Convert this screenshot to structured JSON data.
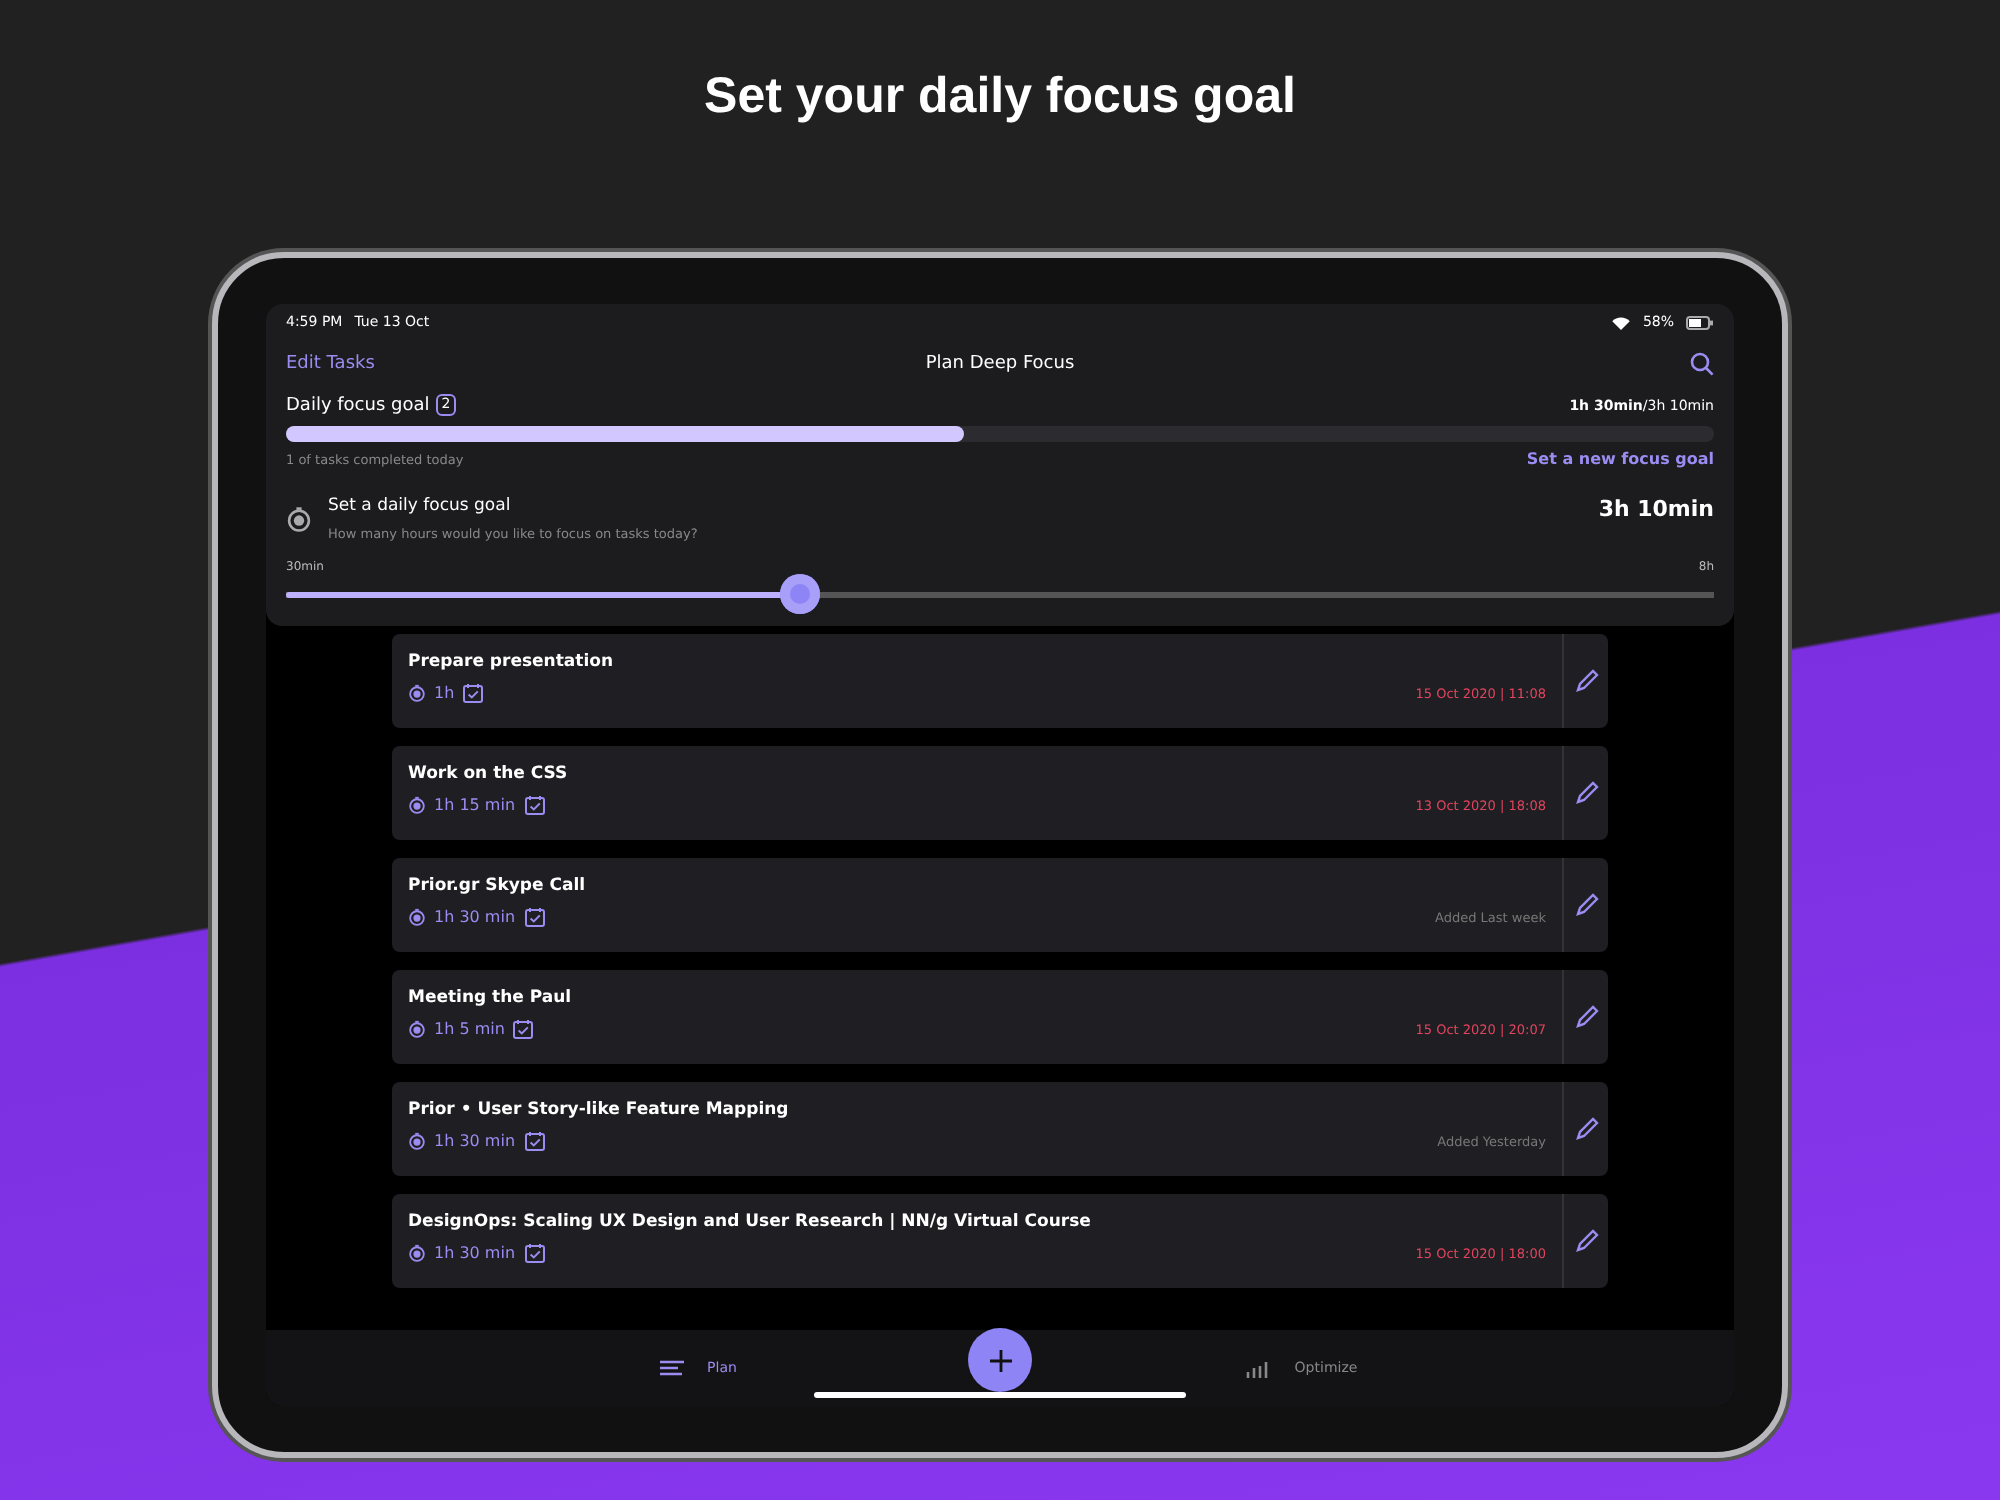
{
  "headline": "Set your daily focus goal",
  "status_bar": {
    "time": "4:59 PM",
    "date": "Tue 13 Oct",
    "battery": "58%"
  },
  "nav": {
    "left": "Edit Tasks",
    "title": "Plan Deep Focus"
  },
  "goal": {
    "label": "Daily focus goal",
    "count": "2",
    "done": "1h 30min",
    "total": "/3h 10min",
    "level": 0.475,
    "completed": "1 of tasks completed today",
    "link": "Set a new focus goal"
  },
  "setter": {
    "title": "Set a daily focus goal",
    "subtitle": "How many hours would you like to focus on tasks today?",
    "value": "3h 10min",
    "min": "30min",
    "max": "8h",
    "level": 0.36
  },
  "tasks": [
    {
      "title": "Prepare presentation",
      "duration": "1h",
      "note": "15 Oct 2020 | 11:08",
      "kind": "due"
    },
    {
      "title": "Work on the CSS",
      "duration": "1h 15 min",
      "note": "13 Oct 2020 | 18:08",
      "kind": "due"
    },
    {
      "title": "Prior.gr Skype Call",
      "duration": "1h 30 min",
      "note": "Added Last week",
      "kind": "added"
    },
    {
      "title": "Meeting the Paul",
      "duration": "1h 5 min",
      "note": "15 Oct 2020 | 20:07",
      "kind": "due"
    },
    {
      "title": "Prior • User Story-like Feature Mapping",
      "duration": "1h 30 min",
      "note": "Added Yesterday",
      "kind": "added"
    },
    {
      "title": "DesignOps: Scaling UX Design and User Research | NN/g Virtual Course",
      "duration": "1h 30 min",
      "note": "15 Oct 2020 | 18:00",
      "kind": "due"
    }
  ],
  "tabs": [
    {
      "label": "Plan",
      "selected": true
    },
    {
      "label": "Optimize",
      "selected": false
    }
  ]
}
